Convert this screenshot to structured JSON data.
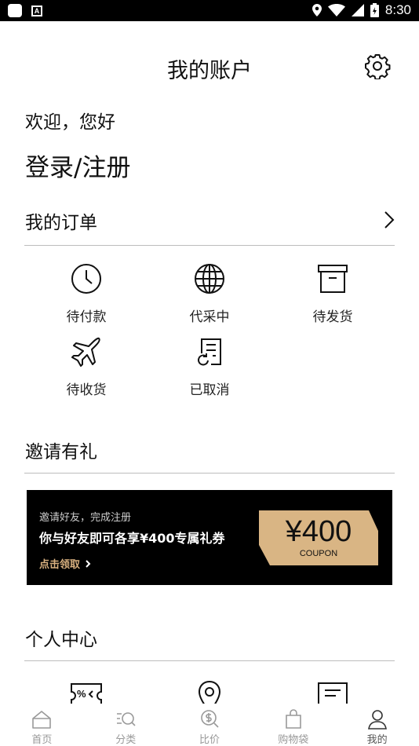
{
  "status_bar": {
    "time": "8:30"
  },
  "header": {
    "title": "我的账户"
  },
  "greeting": {
    "welcome": "欢迎，您好",
    "login": "登录/注册"
  },
  "orders": {
    "title": "我的订单",
    "items": [
      {
        "label": "待付款",
        "icon": "clock-icon"
      },
      {
        "label": "代采中",
        "icon": "globe-icon"
      },
      {
        "label": "待发货",
        "icon": "archive-box-icon"
      },
      {
        "label": "待收货",
        "icon": "airplane-icon"
      },
      {
        "label": "已取消",
        "icon": "document-refresh-icon"
      }
    ]
  },
  "invite": {
    "title": "邀请有礼",
    "banner": {
      "subtitle": "邀请好友，完成注册",
      "headline": "你与好友即可各享¥400专属礼券",
      "link": "点击领取",
      "coupon_amount": "¥400",
      "coupon_label": "COUPON"
    }
  },
  "personal": {
    "title": "个人中心",
    "icons": [
      "discount-tag-icon",
      "location-pin-icon",
      "message-icon"
    ]
  },
  "tabbar": {
    "items": [
      {
        "label": "首页",
        "icon": "home-icon"
      },
      {
        "label": "分类",
        "icon": "category-search-icon"
      },
      {
        "label": "比价",
        "icon": "price-compare-icon"
      },
      {
        "label": "购物袋",
        "icon": "shopping-bag-icon"
      },
      {
        "label": "我的",
        "icon": "profile-icon"
      }
    ],
    "active_index": 4
  },
  "colors": {
    "accent_gold": "#d9b584",
    "link_gold": "#d8b07f",
    "text": "#111111",
    "muted": "#999999"
  }
}
